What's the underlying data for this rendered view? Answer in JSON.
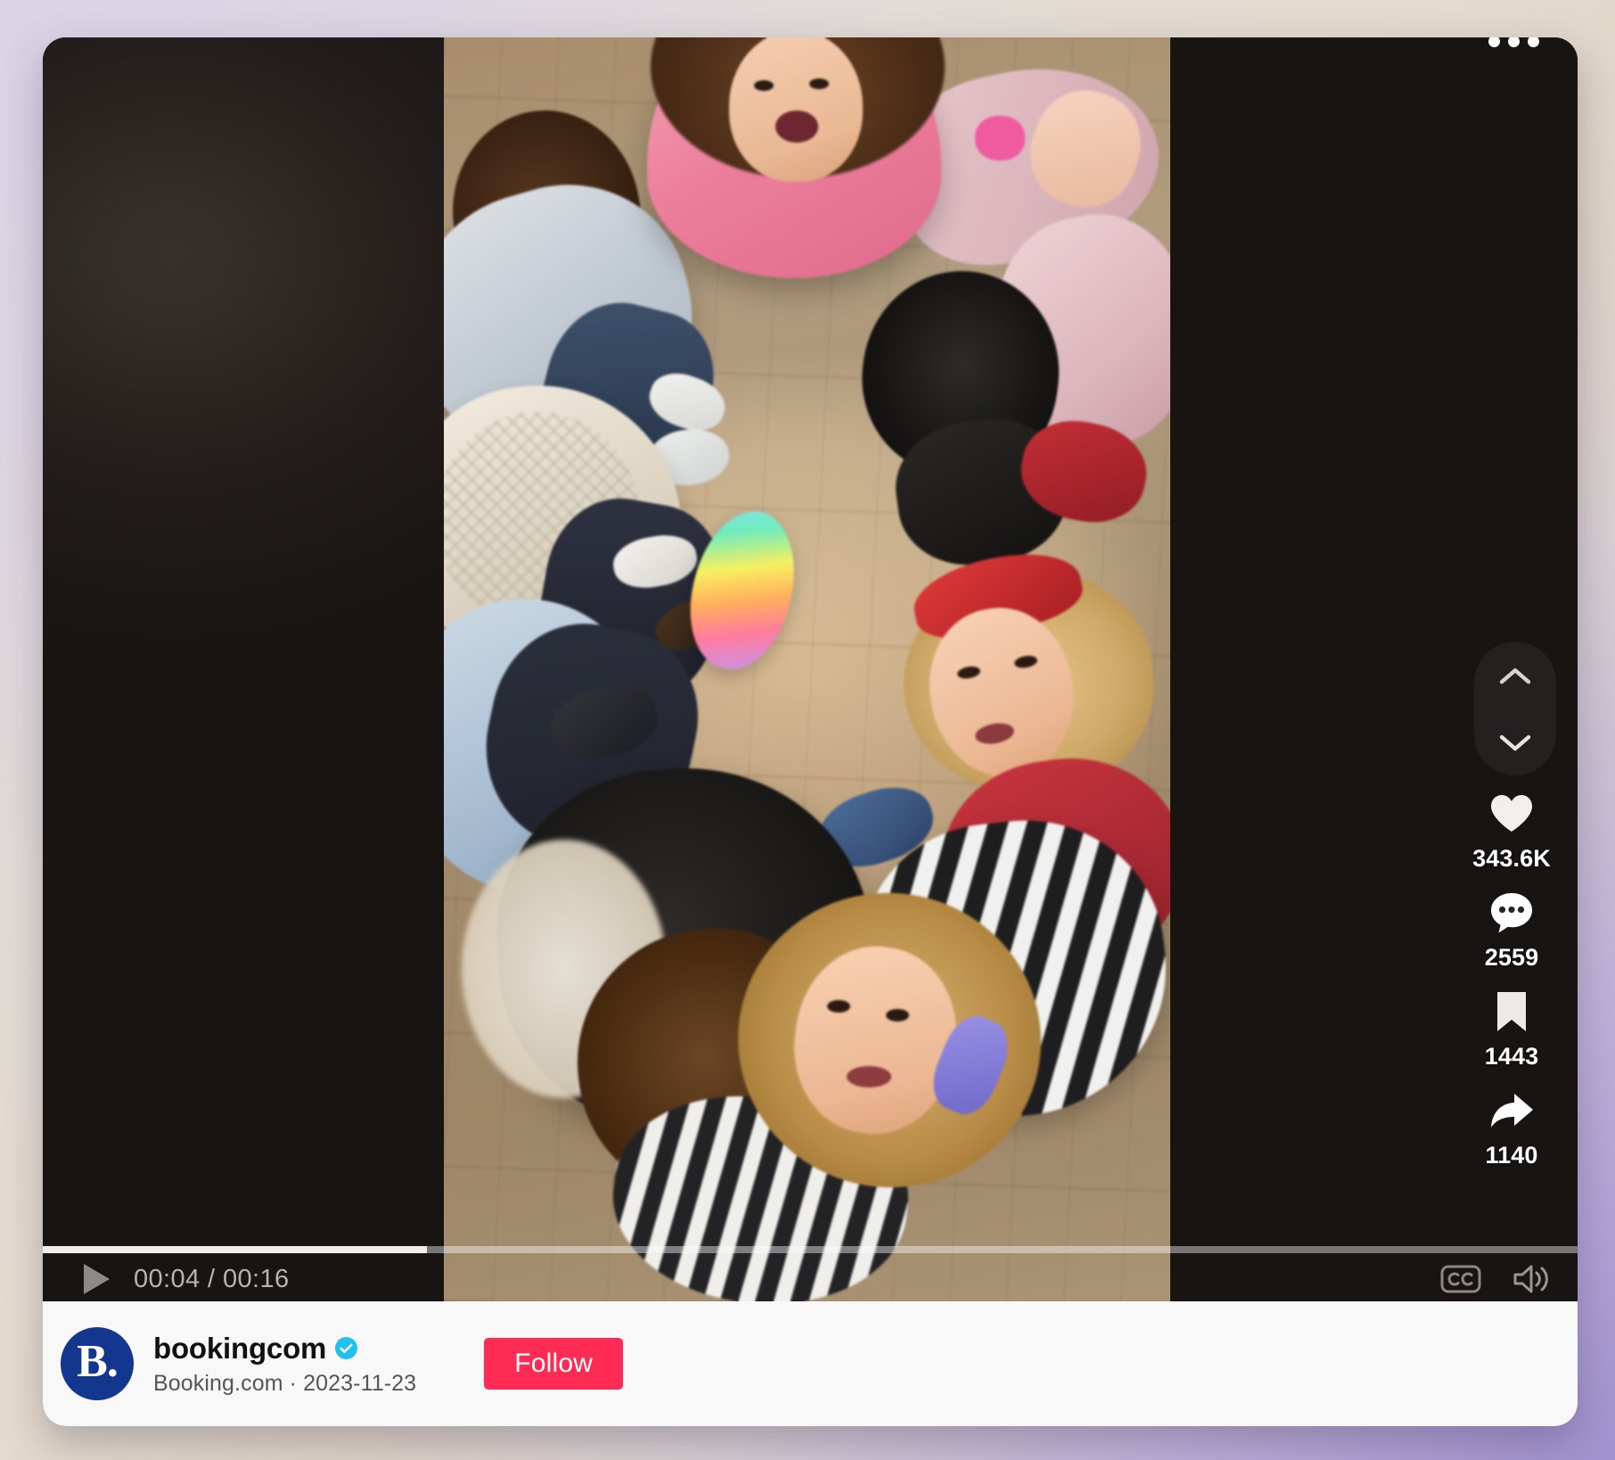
{
  "player": {
    "aria_label": "TikTok video player",
    "more_icon": "ellipsis-icon"
  },
  "video": {
    "scene_description": "Overhead view of a group of people standing in a circle on a wooden floor looking up at the camera"
  },
  "navigation": {
    "previous_label": "Previous video",
    "previous_icon": "chevron-up-icon",
    "next_label": "Next video",
    "next_icon": "chevron-down-icon"
  },
  "actions": [
    {
      "id": "like",
      "icon": "heart-icon",
      "count": "343.6K",
      "label": "Like"
    },
    {
      "id": "comment",
      "icon": "comment-icon",
      "count": "2559",
      "label": "Comments"
    },
    {
      "id": "save",
      "icon": "bookmark-icon",
      "count": "1443",
      "label": "Save"
    },
    {
      "id": "share",
      "icon": "share-icon",
      "count": "1140",
      "label": "Share"
    }
  ],
  "controls": {
    "play_icon": "play-icon",
    "play_label": "Play",
    "current_time": "00:04",
    "duration": "00:16",
    "time_display": "00:04 / 00:16",
    "progress_percent": 25,
    "captions_icon": "closed-captions-icon",
    "captions_label": "CC",
    "volume_icon": "volume-on-icon",
    "volume_label": "Volume"
  },
  "author": {
    "avatar_mark": "B.",
    "handle": "bookingcom",
    "verified": true,
    "verified_icon": "verified-badge-icon",
    "display_name": "Booking.com",
    "date": "2023-11-23",
    "meta": "Booking.com · 2023-11-23",
    "follow_label": "Follow"
  },
  "colors": {
    "follow_button": "#fe2c55",
    "verified_badge": "#20c0f0",
    "avatar_background": "#13368f",
    "footer_background": "#f8f8f8"
  }
}
